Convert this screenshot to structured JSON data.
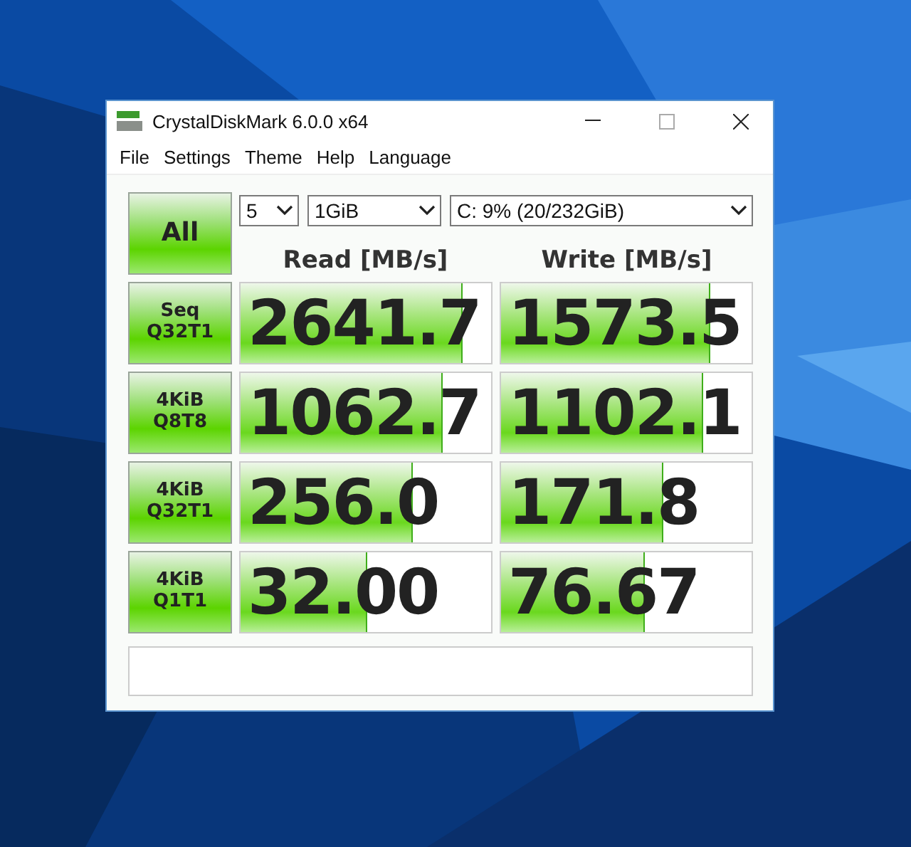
{
  "window": {
    "title": "CrystalDiskMark 6.0.0 x64"
  },
  "menu": [
    "File",
    "Settings",
    "Theme",
    "Help",
    "Language"
  ],
  "all_button": "All",
  "selectors": [
    {
      "value": "5"
    },
    {
      "value": "1GiB"
    },
    {
      "value": "C: 9% (20/232GiB)"
    }
  ],
  "headers": [
    "Read [MB/s]",
    "Write [MB/s]"
  ],
  "tests": [
    {
      "label": [
        "Seq",
        "Q32T1"
      ],
      "read": {
        "value": "2641.7",
        "level": 0.88
      },
      "write": {
        "value": "1573.5",
        "level": 0.83
      }
    },
    {
      "label": [
        "4KiB",
        "Q8T8"
      ],
      "read": {
        "value": "1062.7",
        "level": 0.8
      },
      "write": {
        "value": "1102.1",
        "level": 0.8
      }
    },
    {
      "label": [
        "4KiB",
        "Q32T1"
      ],
      "read": {
        "value": "256.0",
        "level": 0.68
      },
      "write": {
        "value": "171.8",
        "level": 0.64
      }
    },
    {
      "label": [
        "4KiB",
        "Q1T1"
      ],
      "read": {
        "value": "32.00",
        "level": 0.5
      },
      "write": {
        "value": "76.67",
        "level": 0.57
      }
    }
  ]
}
